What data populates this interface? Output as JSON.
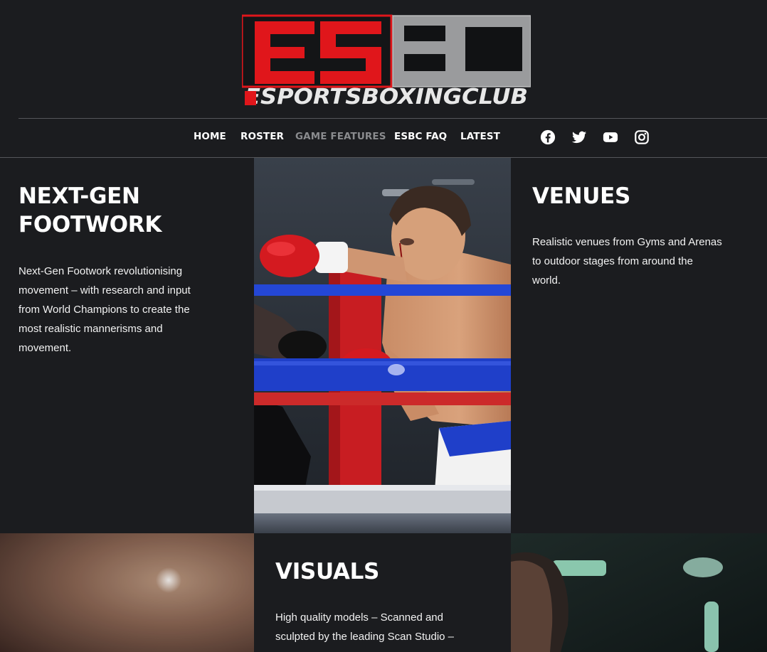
{
  "logo": {
    "letters": [
      "E",
      "S",
      "B",
      "C"
    ],
    "tagline": "ESPORTSBOXINGCLUB",
    "colors": {
      "red": "#e0161b",
      "silver": "#c8c8c8",
      "black": "#111214"
    }
  },
  "nav": {
    "items": [
      {
        "label": "HOME",
        "active": false
      },
      {
        "label": "ROSTER",
        "active": false
      },
      {
        "label": "GAME FEATURES",
        "active": true
      },
      {
        "label": "ESBC FAQ",
        "active": false
      },
      {
        "label": "LATEST",
        "active": false
      }
    ],
    "social": [
      "facebook-icon",
      "twitter-icon",
      "youtube-icon",
      "instagram-icon"
    ]
  },
  "sections": {
    "footwork": {
      "title": "NEXT-GEN FOOTWORK",
      "body": "Next-Gen Footwork revolutionising movement – with research and input from World Champions to create the most realistic mannerisms and movement."
    },
    "venues": {
      "title": "VENUES",
      "body": "Realistic venues from Gyms and Arenas to outdoor stages from around the world."
    },
    "visuals": {
      "title": "VISUALS",
      "body": "High quality models – Scanned and sculpted by the leading Scan Studio –"
    }
  },
  "colors": {
    "background": "#1b1c1f",
    "text": "#ffffff",
    "nav_active": "#8a8b8e",
    "ring_rope_blue": "#1f3fc9",
    "ring_post_red": "#c81d22"
  }
}
